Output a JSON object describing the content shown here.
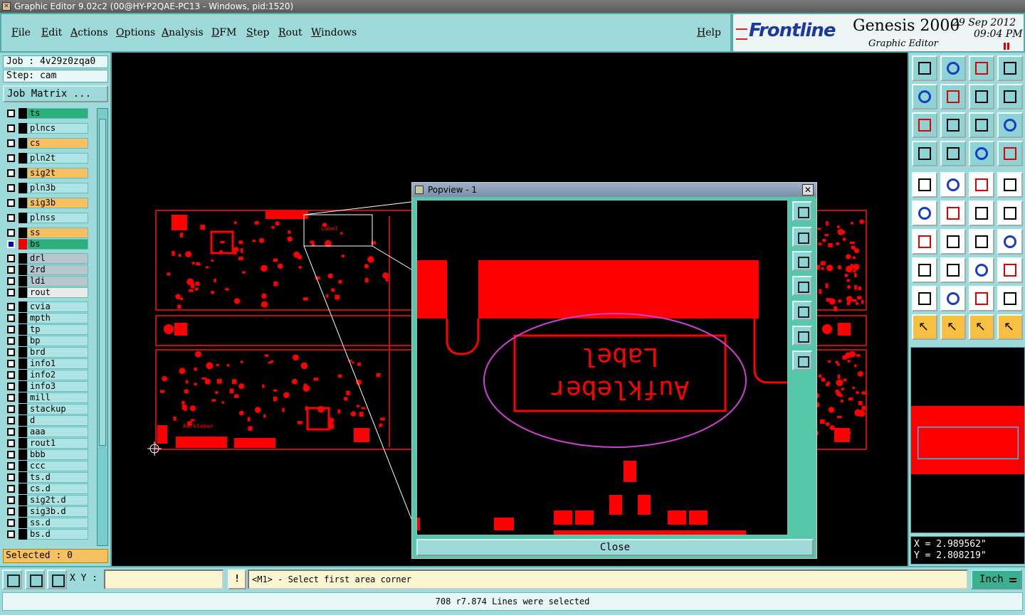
{
  "window": {
    "title": "Graphic Editor 9.02c2 (00@HY-P2QAE-PC13 - Windows, pid:1520)"
  },
  "menu": {
    "items": [
      "File",
      "Edit",
      "Actions",
      "Options",
      "Analysis",
      "DFM",
      "Step",
      "Rout",
      "Windows"
    ],
    "help": "Help"
  },
  "brand": {
    "logo": "Frontline",
    "product": "Genesis 2000",
    "subtitle": "Graphic Editor",
    "date": "29 Sep 2012",
    "time": "09:04 PM"
  },
  "left": {
    "job": "Job : 4v29z0zqa0",
    "step": "Step: cam",
    "job_matrix": "Job Matrix ...",
    "layers": [
      {
        "name": "ts",
        "color": "green"
      },
      {
        "name": "plncs",
        "color": "cyan"
      },
      {
        "name": "cs",
        "color": "orange"
      },
      {
        "name": "pln2t",
        "color": "cyan"
      },
      {
        "name": "sig2t",
        "color": "orange"
      },
      {
        "name": "pln3b",
        "color": "cyan"
      },
      {
        "name": "sig3b",
        "color": "orange"
      },
      {
        "name": "plnss",
        "color": "cyan"
      },
      {
        "name": "ss",
        "color": "orange"
      },
      {
        "name": "bs",
        "color": "green"
      },
      {
        "name": "drl",
        "color": "grey"
      },
      {
        "name": "2rd",
        "color": "grey"
      },
      {
        "name": "ldi",
        "color": "grey"
      },
      {
        "name": "rout",
        "color": "white"
      },
      {
        "name": "cvia",
        "color": "cyan"
      },
      {
        "name": "mpth",
        "color": "cyan"
      },
      {
        "name": "tp",
        "color": "cyan"
      },
      {
        "name": "bp",
        "color": "cyan"
      },
      {
        "name": "brd",
        "color": "cyan"
      },
      {
        "name": "info1",
        "color": "cyan"
      },
      {
        "name": "info2",
        "color": "cyan"
      },
      {
        "name": "info3",
        "color": "cyan"
      },
      {
        "name": "mill",
        "color": "cyan"
      },
      {
        "name": "stackup",
        "color": "cyan"
      },
      {
        "name": "d",
        "color": "cyan"
      },
      {
        "name": "aaa",
        "color": "cyan"
      },
      {
        "name": "rout1",
        "color": "cyan"
      },
      {
        "name": "bbb",
        "color": "cyan"
      },
      {
        "name": "ccc",
        "color": "cyan"
      },
      {
        "name": "ts.d",
        "color": "cyan"
      },
      {
        "name": "cs.d",
        "color": "cyan"
      },
      {
        "name": "sig2t.d",
        "color": "cyan"
      },
      {
        "name": "sig3b.d",
        "color": "cyan"
      },
      {
        "name": "ss.d",
        "color": "cyan"
      },
      {
        "name": "bs.d",
        "color": "cyan"
      }
    ],
    "selected": "Selected : 0"
  },
  "popview": {
    "title": "Popview - 1",
    "close_x": "✕",
    "close_button": "Close",
    "label_text_1": "Label",
    "label_text_2": "Aufkleber"
  },
  "coords": {
    "x": "X = 2.989562\"",
    "y": "Y = 2.808219\""
  },
  "bottom": {
    "xy_label": "X Y :",
    "xy_value": "",
    "warn": "!",
    "prompt": "<M1> - Select first area corner",
    "unit": "Inch"
  },
  "status": {
    "message": "708 r7.874 Lines were selected"
  },
  "colors": {
    "panel": "#9fdada",
    "copper": "#ff0000",
    "highlight_ellipse": "#d040d0"
  }
}
